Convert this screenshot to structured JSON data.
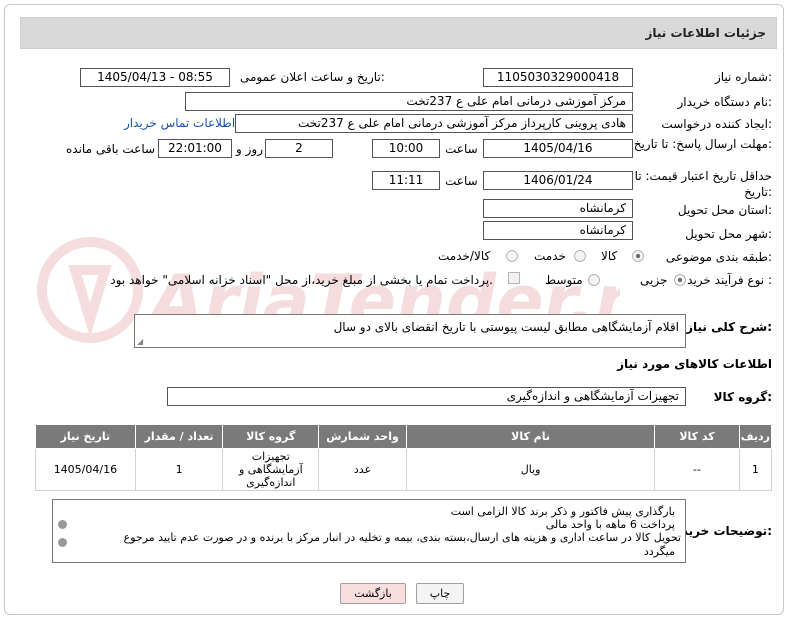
{
  "header": {
    "title": "جزئیات اطلاعات نیاز"
  },
  "fields": {
    "need_number_label": "شماره نیاز:",
    "need_number": "1105030329000418",
    "announce_label": "تاریخ و ساعت اعلان عمومی:",
    "announce_value": "1405/04/13 - 08:55",
    "buyer_org_label": "نام دستگاه خریدار:",
    "buyer_org": "مرکز آموزشی درمانی امام علی ع 237تخت",
    "creator_label": "ایجاد کننده درخواست:",
    "creator": "هادی پروینی کارپرداز  مرکز آموزشی درمانی امام علی ع 237تخت",
    "contact_link": "اطلاعات تماس خریدار",
    "reply_deadline_label": "مهلت ارسال پاسخ: تا تاریخ:",
    "reply_date": "1405/04/16",
    "time_label": "ساعت",
    "reply_time": "10:00",
    "days_value": "2",
    "days_label": "روز و",
    "remaining_time": "22:01:00",
    "remaining_label": "ساعت باقی مانده",
    "price_validity_label": "حداقل تاریخ اعتبار قیمت: تا تاریخ:",
    "price_date": "1406/01/24",
    "price_time_label": "ساعت",
    "price_time": "11:11",
    "province_label": "استان محل تحویل:",
    "province": "کرمانشاه",
    "city_label": "شهر محل تحویل:",
    "city": "کرمانشاه",
    "category_label": "طبقه بندی موضوعی:",
    "category_options": [
      "کالا",
      "خدمت",
      "کالا/خدمت"
    ],
    "process_label": "نوع فرآیند خرید :",
    "process_options": [
      "جزیی",
      "متوسط"
    ],
    "payment_note": "پرداخت تمام یا بخشی از مبلغ خرید،از محل \"اسناد خزانه اسلامی\" خواهد بود."
  },
  "description": {
    "label": "شرح کلی نیاز:",
    "value": "اقلام آزمایشگاهی مطابق لیست پیوستی با تاریخ انقضای بالای دو سال"
  },
  "goods_info_title": "اطلاعات کالاهای مورد نیاز",
  "goods_group": {
    "label": "گروه کالا:",
    "value": "تجهیزات آزمایشگاهی و اندازه‌گیری"
  },
  "table": {
    "headers": [
      "ردیف",
      "کد کالا",
      "نام کالا",
      "واحد شمارش",
      "گروه کالا",
      "تعداد / مقدار",
      "تاریخ نیاز"
    ],
    "rows": [
      {
        "row": "1",
        "code": "--",
        "name": "ویال",
        "unit": "عدد",
        "group": "تجهیزات آزمایشگاهی و اندازه‌گیری",
        "qty": "1",
        "date": "1405/04/16"
      }
    ]
  },
  "buyer_notes": {
    "label": "توضیحات خریدار:",
    "lines": [
      "بارگذاری پیش فاکتور و ذکر برند کالا الزامی است",
      "پرداخت 6 ماهه با واحد مالی",
      "تحویل کالا در ساعت اداری و هزینه های ارسال،بسته بندی، بیمه و تخلیه در انبار مرکز با برنده و در صورت عدم تایید مرجوع",
      "میگردد"
    ]
  },
  "buttons": {
    "print": "چاپ",
    "back": "بازگشت"
  },
  "colors": {
    "header_bg": "#d9d9d9",
    "table_header_bg": "#7a7a7a",
    "link": "#1a4fb0",
    "back_button_bg": "#f9dede"
  }
}
